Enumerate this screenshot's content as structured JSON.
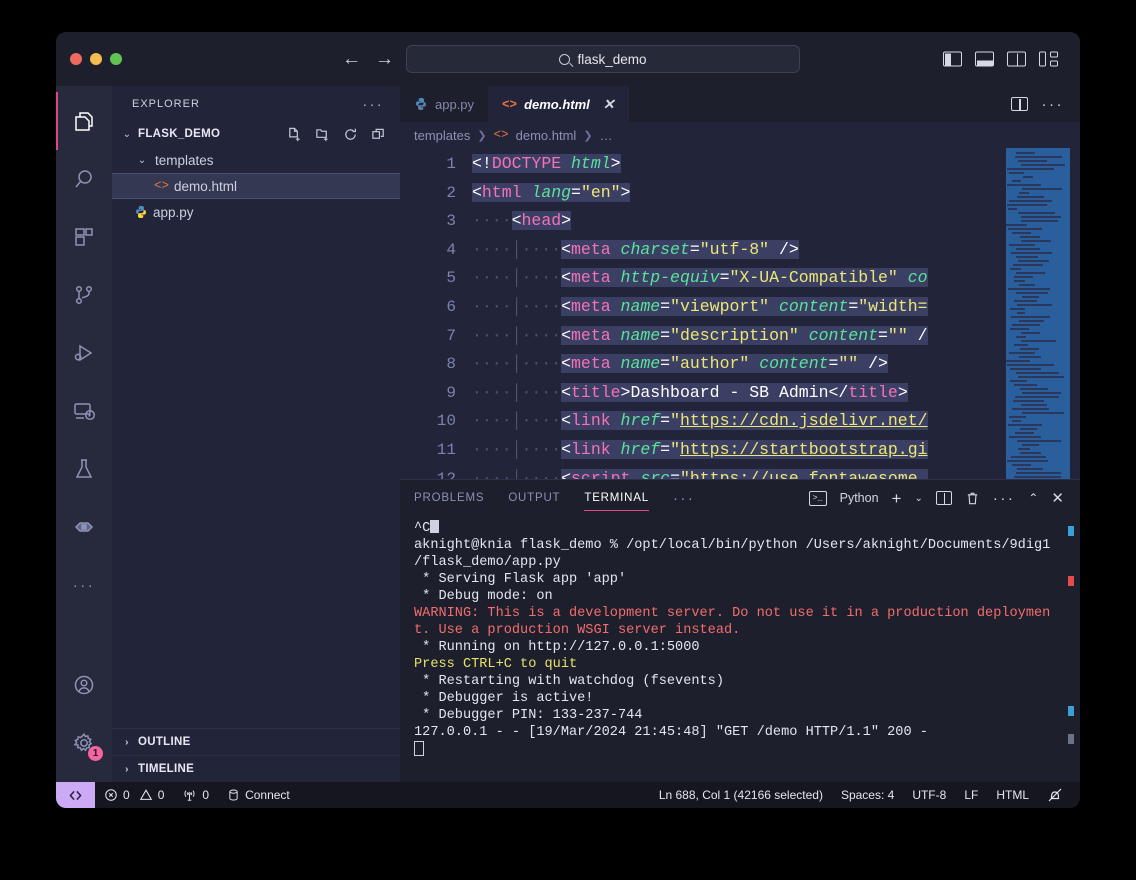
{
  "titlebar": {
    "search_value": "flask_demo",
    "search_icon": "search-icon",
    "back_icon": "←",
    "forward_icon": "→",
    "layout_icons": [
      "toggle-primary-sidebar-icon",
      "toggle-panel-icon",
      "toggle-secondary-sidebar-icon",
      "customize-layout-icon"
    ]
  },
  "activitybar": {
    "items": [
      {
        "name": "explorer",
        "active": true
      },
      {
        "name": "search",
        "active": false
      },
      {
        "name": "extensions",
        "active": false
      },
      {
        "name": "source-control",
        "active": false
      },
      {
        "name": "run-and-debug",
        "active": false
      },
      {
        "name": "remote-explorer",
        "active": false
      },
      {
        "name": "testing",
        "active": false
      },
      {
        "name": "docker",
        "active": false
      }
    ],
    "more_label": "···",
    "account_label": "account",
    "settings_badge": "1"
  },
  "sidebar": {
    "title": "EXPLORER",
    "more_label": "···",
    "root": {
      "label": "FLASK_DEMO",
      "expanded": true,
      "actions": [
        "new-file-icon",
        "new-folder-icon",
        "refresh-icon",
        "collapse-all-icon"
      ]
    },
    "tree": [
      {
        "label": "templates",
        "type": "folder",
        "depth": 1,
        "expanded": true,
        "selected": false
      },
      {
        "label": "demo.html",
        "type": "html",
        "depth": 2,
        "expanded": false,
        "selected": true
      },
      {
        "label": "app.py",
        "type": "python",
        "depth": 1,
        "expanded": false,
        "selected": false
      }
    ],
    "sections": [
      {
        "label": "OUTLINE"
      },
      {
        "label": "TIMELINE"
      }
    ]
  },
  "editor": {
    "tabs": [
      {
        "label": "app.py",
        "icon": "python-icon",
        "active": false,
        "closable": false
      },
      {
        "label": "demo.html",
        "icon": "html-icon",
        "active": true,
        "closable": true
      }
    ],
    "close_label": "✕",
    "actions": [
      "split-editor-icon",
      "more-actions-icon"
    ],
    "breadcrumb": [
      "templates",
      "demo.html",
      "…"
    ],
    "first_line_number": 1,
    "lines": [
      {
        "n": 1,
        "text": "<!DOCTYPE html>"
      },
      {
        "n": 2,
        "text": "<html lang=\"en\">"
      },
      {
        "n": 3,
        "text": "    <head>"
      },
      {
        "n": 4,
        "text": "        <meta charset=\"utf-8\" />"
      },
      {
        "n": 5,
        "text": "        <meta http-equiv=\"X-UA-Compatible\" co"
      },
      {
        "n": 6,
        "text": "        <meta name=\"viewport\" content=\"width="
      },
      {
        "n": 7,
        "text": "        <meta name=\"description\" content=\"\" /"
      },
      {
        "n": 8,
        "text": "        <meta name=\"author\" content=\"\" />"
      },
      {
        "n": 9,
        "text": "        <title>Dashboard - SB Admin</title>"
      },
      {
        "n": 10,
        "text": "        <link href=\"https://cdn.jsdelivr.net/"
      },
      {
        "n": 11,
        "text": "        <link href=\"https://startbootstrap.gi"
      },
      {
        "n": 12,
        "text": "        <script src=\"https://use.fontawesome."
      }
    ]
  },
  "panel": {
    "tabs": [
      {
        "label": "PROBLEMS",
        "active": false
      },
      {
        "label": "OUTPUT",
        "active": false
      },
      {
        "label": "TERMINAL",
        "active": true
      }
    ],
    "more_label": "···",
    "shell_label": "Python",
    "actions": [
      "new-terminal-icon",
      "terminal-dropdown-icon",
      "split-terminal-icon",
      "kill-terminal-icon",
      "more-actions-icon",
      "maximize-panel-icon",
      "close-panel-icon"
    ],
    "terminal_lines": [
      {
        "text": "^C",
        "style": "normal",
        "cursor": "block-small"
      },
      {
        "text": "aknight@knia flask_demo % /opt/local/bin/python /Users/aknight/Documents/9dig1",
        "style": "normal",
        "marker": true
      },
      {
        "text": "/flask_demo/app.py",
        "style": "normal"
      },
      {
        "text": " * Serving Flask app 'app'",
        "style": "normal"
      },
      {
        "text": " * Debug mode: on",
        "style": "normal"
      },
      {
        "text": "WARNING: This is a development server. Do not use it in a production deploymen",
        "style": "warn"
      },
      {
        "text": "t. Use a production WSGI server instead.",
        "style": "warn"
      },
      {
        "text": " * Running on http://127.0.0.1:5000",
        "style": "normal"
      },
      {
        "text": "Press CTRL+C to quit",
        "style": "yellow"
      },
      {
        "text": " * Restarting with watchdog (fsevents)",
        "style": "normal"
      },
      {
        "text": " * Debugger is active!",
        "style": "normal"
      },
      {
        "text": " * Debugger PIN: 133-237-744",
        "style": "normal"
      },
      {
        "text": "127.0.0.1 - - [19/Mar/2024 21:45:48] \"GET /demo HTTP/1.1\" 200 -",
        "style": "normal"
      },
      {
        "text": "",
        "style": "normal",
        "cursor": "outline"
      }
    ]
  },
  "statusbar": {
    "remote_label": "",
    "remote_icon": "remote-window-icon",
    "errors": "0",
    "warnings": "0",
    "ports": "0",
    "connect_label": "Connect",
    "cursor_position": "Ln 688, Col 1 (42166 selected)",
    "indentation": "Spaces: 4",
    "encoding": "UTF-8",
    "eol": "LF",
    "language": "HTML",
    "bell_icon": "notifications-dnd-icon"
  },
  "colors": {
    "accent_pink": "#e0458a",
    "remote_purple": "#cdaaf5",
    "badge_pink": "#f4649f",
    "tag": "#f472b6",
    "attribute": "#5ae39a",
    "string": "#ece775",
    "warning_red": "#f26d6d"
  }
}
